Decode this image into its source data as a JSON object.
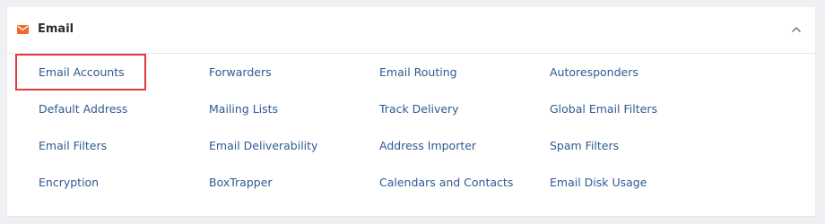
{
  "panel": {
    "title": "Email",
    "icon": "mail-icon",
    "accent_color": "#ef6a2a",
    "collapse_icon": "chevron-up-icon"
  },
  "links": [
    [
      "Email Accounts",
      "Forwarders",
      "Email Routing",
      "Autoresponders"
    ],
    [
      "Default Address",
      "Mailing Lists",
      "Track Delivery",
      "Global Email Filters"
    ],
    [
      "Email Filters",
      "Email Deliverability",
      "Address Importer",
      "Spam Filters"
    ],
    [
      "Encryption",
      "BoxTrapper",
      "Calendars and Contacts",
      "Email Disk Usage"
    ]
  ],
  "selected_link": "Email Accounts",
  "selected_outline_color": "#e23c3c",
  "link_color": "#2e5a92"
}
